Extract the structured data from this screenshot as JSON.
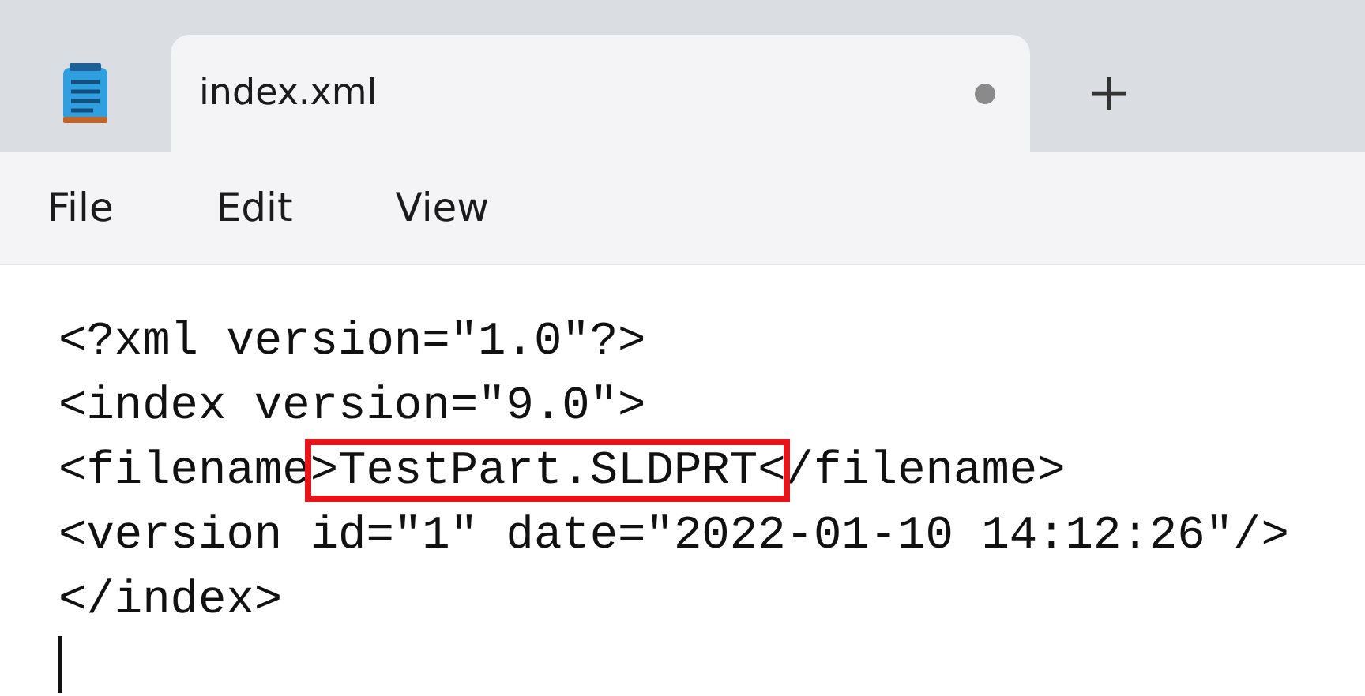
{
  "tabs": [
    {
      "label": "index.xml",
      "selected": true,
      "modified": true
    }
  ],
  "new_tab": "+",
  "menu": [
    "File",
    "Edit",
    "View"
  ],
  "lines": [
    {
      "segments": [
        {
          "text": "<?xml version=\"1.0\"?>",
          "highlighted": false
        }
      ],
      "cursor": false
    },
    {
      "segments": [
        {
          "text": "<index version=\"9.0\">",
          "highlighted": false
        }
      ],
      "cursor": false
    },
    {
      "segments": [
        {
          "text": "<filename",
          "highlighted": false
        },
        {
          "text": ">TestPart.SLDPRT<",
          "highlighted": true
        },
        {
          "text": "/filename>",
          "highlighted": false
        }
      ],
      "cursor": false
    },
    {
      "segments": [
        {
          "text": "<version id=\"1\" date=\"2022-01-10 14:12:26\"/>",
          "highlighted": false
        }
      ],
      "cursor": false
    },
    {
      "segments": [
        {
          "text": "</index>",
          "highlighted": false
        }
      ],
      "cursor": false
    },
    {
      "cursor": true
    }
  ]
}
